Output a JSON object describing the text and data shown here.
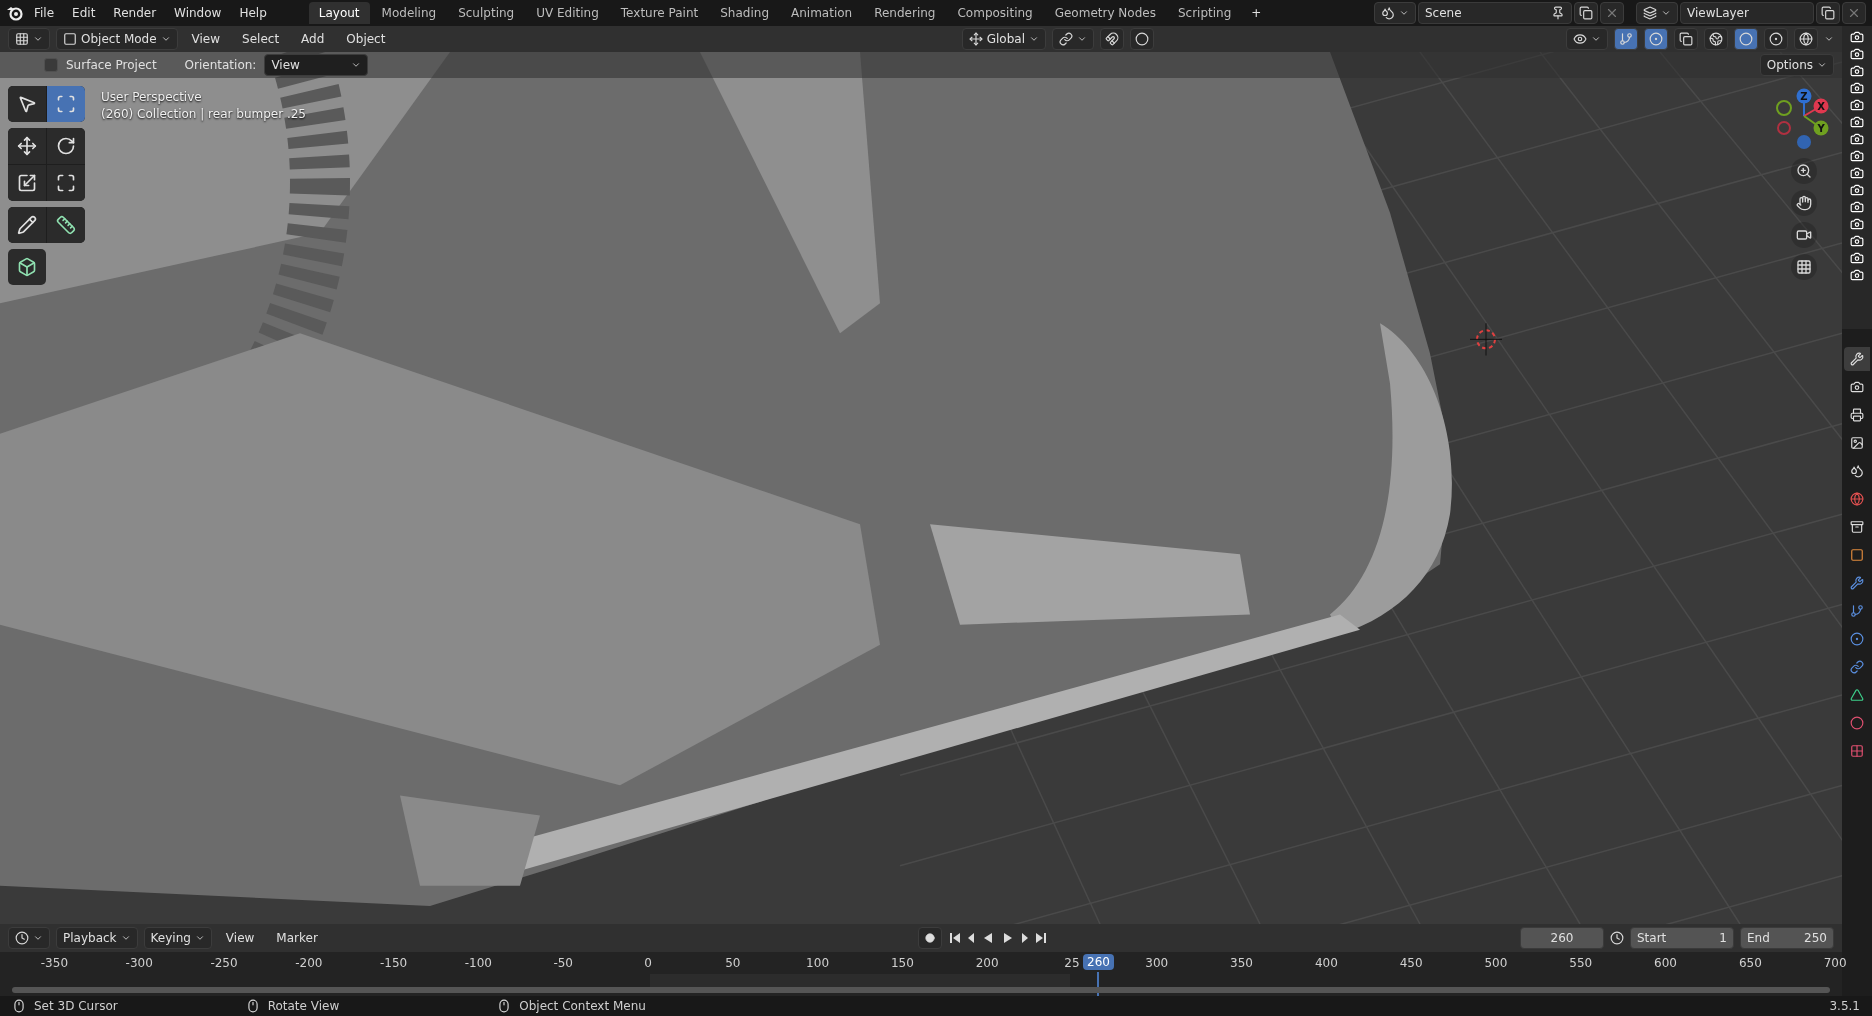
{
  "topbar": {
    "menus": [
      "File",
      "Edit",
      "Render",
      "Window",
      "Help"
    ],
    "workspaces": [
      {
        "label": "Layout",
        "selected": true
      },
      {
        "label": "Modeling",
        "selected": false
      },
      {
        "label": "Sculpting",
        "selected": false
      },
      {
        "label": "UV Editing",
        "selected": false
      },
      {
        "label": "Texture Paint",
        "selected": false
      },
      {
        "label": "Shading",
        "selected": false
      },
      {
        "label": "Animation",
        "selected": false
      },
      {
        "label": "Rendering",
        "selected": false
      },
      {
        "label": "Compositing",
        "selected": false
      },
      {
        "label": "Geometry Nodes",
        "selected": false
      },
      {
        "label": "Scripting",
        "selected": false
      }
    ],
    "add_tab": "+",
    "scene": "Scene",
    "view_layer": "ViewLayer"
  },
  "header": {
    "mode": "Object Mode",
    "menus": [
      "View",
      "Select",
      "Add",
      "Object"
    ],
    "orientation": "Global",
    "shading": [
      {
        "selected": false
      },
      {
        "selected": true
      },
      {
        "selected": false
      },
      {
        "selected": false
      }
    ]
  },
  "tool_settings": {
    "surface_project": {
      "label": "Surface Project",
      "checked": false
    },
    "orientation_label": "Orientation:",
    "orientation_value": "View",
    "options": "Options"
  },
  "viewport": {
    "info": [
      "User Perspective",
      "(260) Collection | rear bumper .25"
    ],
    "tools": [
      {
        "selected": false
      },
      {
        "selected": true
      },
      {
        "selected": false
      },
      {
        "selected": false
      },
      {
        "selected": false
      },
      {
        "selected": false
      },
      {
        "selected": false
      },
      {
        "selected": false
      },
      {
        "selected": false
      }
    ],
    "gizmo_axes": [
      "Z",
      "X",
      "Y"
    ]
  },
  "properties_tabs": [
    {
      "selected": true
    },
    {
      "selected": false
    },
    {
      "selected": false
    },
    {
      "selected": false
    },
    {
      "selected": false
    },
    {
      "selected": false
    },
    {
      "selected": false
    },
    {
      "selected": false
    },
    {
      "selected": false
    },
    {
      "selected": false
    },
    {
      "selected": false
    },
    {
      "selected": false
    },
    {
      "selected": false
    },
    {
      "selected": false
    },
    {
      "selected": false
    }
  ],
  "timeline": {
    "menus": [
      "Playback",
      "Keying",
      "View",
      "Marker"
    ],
    "current_frame": "260",
    "start_label": "Start",
    "start": "1",
    "end_label": "End",
    "end": "250",
    "ticks": [
      "-350",
      "-300",
      "-250",
      "-200",
      "-150",
      "-100",
      "-50",
      "0",
      "50",
      "100",
      "150",
      "200",
      "25",
      "300",
      "350",
      "400",
      "450",
      "500",
      "550",
      "600",
      "650",
      "700"
    ],
    "playhead": "260"
  },
  "status_bar": {
    "items": [
      "Set 3D Cursor",
      "Rotate View",
      "Object Context Menu"
    ],
    "version": "3.5.1"
  }
}
